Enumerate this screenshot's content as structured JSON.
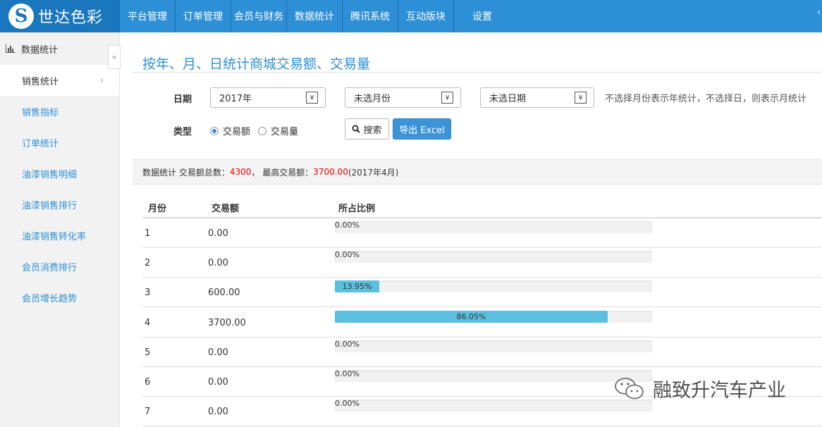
{
  "brand": {
    "logo_letter": "S",
    "name": "世达色彩"
  },
  "nav": [
    "平台管理",
    "订单管理",
    "会员与财务",
    "数据统计",
    "腾讯系统",
    "互动版块",
    "设置"
  ],
  "top_more": "‹",
  "sidebar": {
    "section": "数据统计",
    "collapse": "«",
    "items": [
      {
        "label": "销售统计",
        "active": true,
        "chevron": "›"
      },
      {
        "label": "销售指标"
      },
      {
        "label": "订单统计"
      },
      {
        "label": "油漆销售明细"
      },
      {
        "label": "油漆销售排行"
      },
      {
        "label": "油漆销售转化率"
      },
      {
        "label": "会员消费排行"
      },
      {
        "label": "会员增长趋势"
      }
    ]
  },
  "page": {
    "title": "按年、月、日统计商城交易额、交易量",
    "date_label": "日期",
    "year_select": "2017年",
    "month_select": "未选月份",
    "day_select": "未选日期",
    "caret": "∨",
    "hint": "不选择月份表示年统计，不选择日，则表示月统计",
    "type_label": "类型",
    "radio_amount": "交易额",
    "radio_volume": "交易量",
    "search_button": "搜索",
    "export_button": "导出 Excel"
  },
  "stats": {
    "prefix": "数据统计 交易额总数：",
    "total": "4300",
    "sep": "， 最高交易额：",
    "max": "3700.00",
    "max_note": " (2017年4月)"
  },
  "table": {
    "headers": [
      "月份",
      "交易额",
      "所占比例"
    ],
    "rows": [
      {
        "month": "1",
        "amount": "0.00",
        "pct_label": "0.00%",
        "ratio": 0
      },
      {
        "month": "2",
        "amount": "0.00",
        "pct_label": "0.00%",
        "ratio": 0
      },
      {
        "month": "3",
        "amount": "600.00",
        "pct_label": "13.95%",
        "ratio": 0.1395
      },
      {
        "month": "4",
        "amount": "3700.00",
        "pct_label": "86.05%",
        "ratio": 0.8605
      },
      {
        "month": "5",
        "amount": "0.00",
        "pct_label": "0.00%",
        "ratio": 0
      },
      {
        "month": "6",
        "amount": "0.00",
        "pct_label": "0.00%",
        "ratio": 0
      },
      {
        "month": "7",
        "amount": "0.00",
        "pct_label": "0.00%",
        "ratio": 0
      }
    ]
  },
  "watermark": "融致升汽车产业",
  "colors": {
    "primary": "#2d8fd5",
    "bar": "#5bc0de",
    "highlight": "#e00"
  }
}
